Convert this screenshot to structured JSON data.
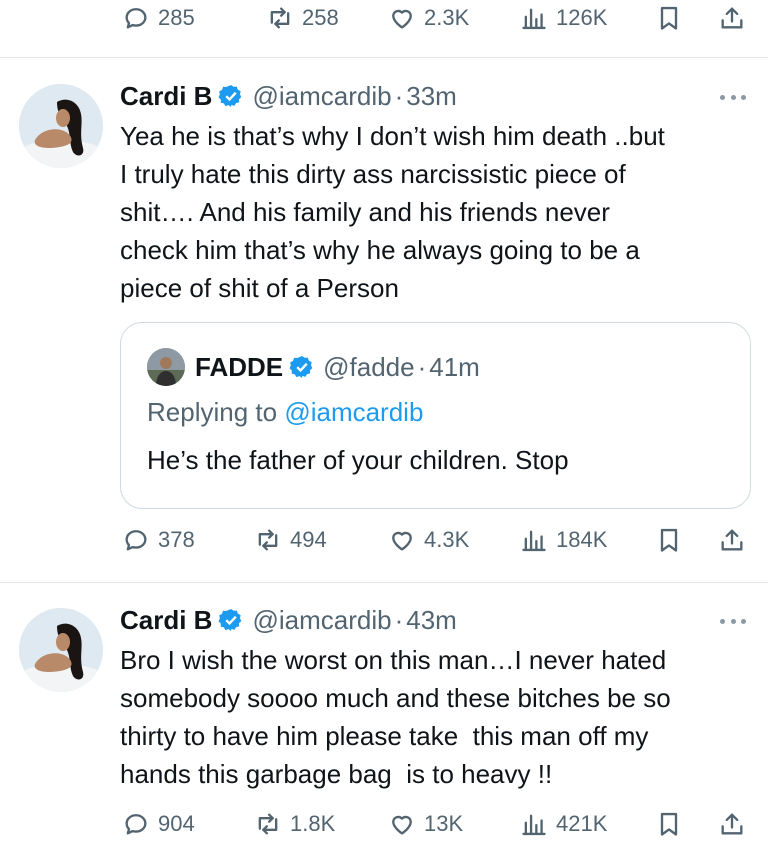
{
  "top_actions": {
    "replies": "285",
    "retweets": "258",
    "likes": "2.3K",
    "views": "126K"
  },
  "tweets": [
    {
      "name": "Cardi B",
      "handle": "@iamcardib",
      "separator": "·",
      "time": "33m",
      "text_lines": [
        "Yea he is that’s why I don’t wish him death ..but",
        "I truly hate this dirty ass narcissistic piece of",
        "shit…. And his family and his friends never",
        "check him that’s why he always going to be a",
        "piece of shit of a Person"
      ],
      "quote": {
        "name": "FADDE",
        "handle": "@fadde",
        "separator": "·",
        "time": "41m",
        "replying_prefix": "Replying to",
        "replying_to": "@iamcardib",
        "text": "He’s the father of your children. Stop"
      },
      "actions": {
        "replies": "378",
        "retweets": "494",
        "likes": "4.3K",
        "views": "184K"
      }
    },
    {
      "name": "Cardi B",
      "handle": "@iamcardib",
      "separator": "·",
      "time": "43m",
      "text_lines": [
        "Bro I wish the worst on this man…I never hated",
        "somebody soooo much and these bitches be so",
        "thirty to have him please take  this man off my",
        "hands this garbage bag  is to heavy !!"
      ],
      "actions": {
        "replies": "904",
        "retweets": "1.8K",
        "likes": "13K",
        "views": "421K"
      }
    }
  ],
  "colors": {
    "verified": "#1d9bf0",
    "link": "#1d9bf0",
    "muted": "#536471",
    "text": "#0f1419"
  },
  "icons": [
    "reply-icon",
    "retweet-icon",
    "like-icon",
    "views-icon",
    "bookmark-icon",
    "share-icon",
    "verified-badge-icon",
    "more-icon"
  ]
}
